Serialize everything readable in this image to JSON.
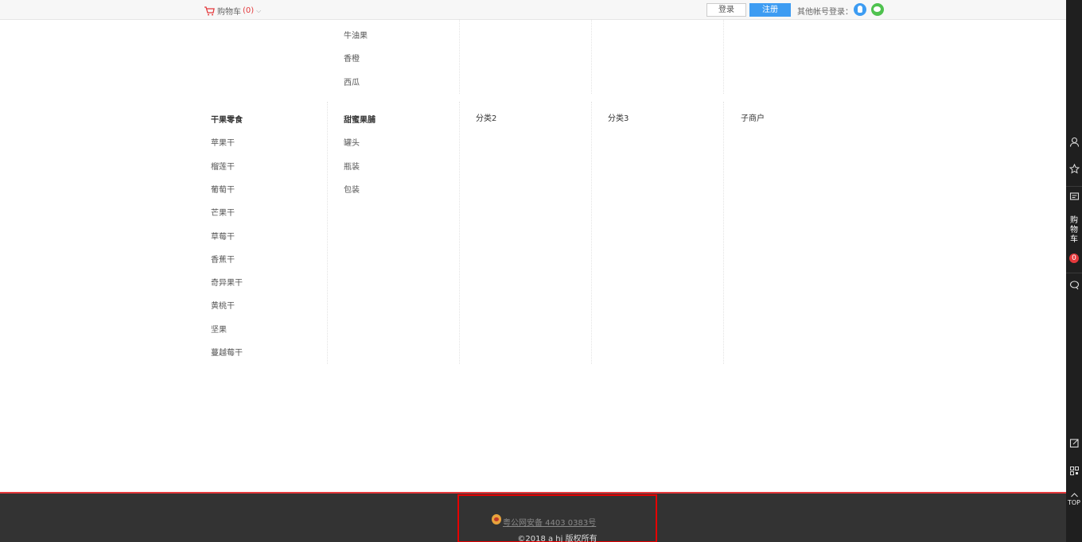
{
  "topbar": {
    "cart_label": "购物车",
    "cart_count": "(0)",
    "login_label": "登录",
    "register_label": "注册",
    "other_login_label": "其他帐号登录："
  },
  "menu": {
    "col2_top_items": [
      "牛油果",
      "香橙",
      "西瓜"
    ],
    "col1_heading": "干果零食",
    "col1_items": [
      "苹果干",
      "榴莲干",
      "葡萄干",
      "芒果干",
      "草莓干",
      "香蕉干",
      "奇异果干",
      "黄桃干",
      "坚果",
      "蔓越莓干"
    ],
    "col2_heading": "甜蜜果脯",
    "col2_items": [
      "罐头",
      "瓶装",
      "包装"
    ],
    "col3_heading": "分类2",
    "col4_heading": "分类3",
    "col5_heading": "子商户"
  },
  "footer": {
    "record_text": "粤公网安备 4403         0383号",
    "copyright": "©2018 a      hj 版权所有"
  },
  "sidebar": {
    "cart_label": "购物车",
    "cart_badge": "0",
    "top_label": "TOP"
  },
  "colors": {
    "accent_blue": "#3d9cf2",
    "accent_red": "#e4393c",
    "footer_bg": "#333333",
    "sidebar_bg": "#1f1f1f"
  }
}
